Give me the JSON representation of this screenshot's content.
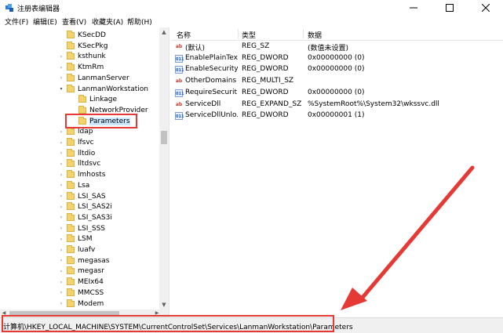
{
  "window": {
    "title": "注册表编辑器"
  },
  "menu": [
    "文件(F)",
    "编辑(E)",
    "查看(V)",
    "收藏夹(A)",
    "帮助(H)"
  ],
  "tree": [
    {
      "label": "KSecDD",
      "expandable": false
    },
    {
      "label": "KSecPkg",
      "expandable": false
    },
    {
      "label": "ksthunk",
      "expandable": true
    },
    {
      "label": "KtmRm",
      "expandable": true
    },
    {
      "label": "LanmanServer",
      "expandable": true
    },
    {
      "label": "LanmanWorkstation",
      "expandable": true,
      "expanded": true
    },
    {
      "label": "Linkage",
      "expandable": false,
      "child": true
    },
    {
      "label": "NetworkProvider",
      "expandable": false,
      "child": true
    },
    {
      "label": "Parameters",
      "expandable": false,
      "child": true,
      "selected": true
    },
    {
      "label": "ldap",
      "expandable": true
    },
    {
      "label": "lfsvc",
      "expandable": true
    },
    {
      "label": "lltdio",
      "expandable": true
    },
    {
      "label": "lltdsvc",
      "expandable": true
    },
    {
      "label": "lmhosts",
      "expandable": true
    },
    {
      "label": "Lsa",
      "expandable": true
    },
    {
      "label": "LSI_SAS",
      "expandable": true
    },
    {
      "label": "LSI_SAS2i",
      "expandable": true
    },
    {
      "label": "LSI_SAS3i",
      "expandable": true
    },
    {
      "label": "LSI_SSS",
      "expandable": true
    },
    {
      "label": "LSM",
      "expandable": true
    },
    {
      "label": "luafv",
      "expandable": true
    },
    {
      "label": "megasas",
      "expandable": true
    },
    {
      "label": "megasr",
      "expandable": true
    },
    {
      "label": "MEIx64",
      "expandable": true
    },
    {
      "label": "MMCSS",
      "expandable": true
    },
    {
      "label": "Modem",
      "expandable": true
    }
  ],
  "columns": {
    "name": "名称",
    "type": "类型",
    "data": "数据"
  },
  "values": [
    {
      "icon": "ab",
      "name": "(默认)",
      "type": "REG_SZ",
      "data": "(数值未设置)"
    },
    {
      "icon": "bin",
      "name": "EnablePlainTex...",
      "type": "REG_DWORD",
      "data": "0x00000000 (0)"
    },
    {
      "icon": "bin",
      "name": "EnableSecurity...",
      "type": "REG_DWORD",
      "data": "0x00000000 (0)"
    },
    {
      "icon": "ab",
      "name": "OtherDomains",
      "type": "REG_MULTI_SZ",
      "data": ""
    },
    {
      "icon": "bin",
      "name": "RequireSecurit...",
      "type": "REG_DWORD",
      "data": "0x00000000 (0)"
    },
    {
      "icon": "ab",
      "name": "ServiceDll",
      "type": "REG_EXPAND_SZ",
      "data": "%SystemRoot%\\System32\\wkssvc.dll"
    },
    {
      "icon": "bin",
      "name": "ServiceDllUnlo...",
      "type": "REG_DWORD",
      "data": "0x00000001 (1)"
    }
  ],
  "status": {
    "path": "计算机\\HKEY_LOCAL_MACHINE\\SYSTEM\\CurrentControlSet\\Services\\LanmanWorkstation\\Parameters"
  },
  "colors": {
    "annotation": "#e53935",
    "folder": "#f5d36b",
    "selection": "#cce8ff"
  }
}
